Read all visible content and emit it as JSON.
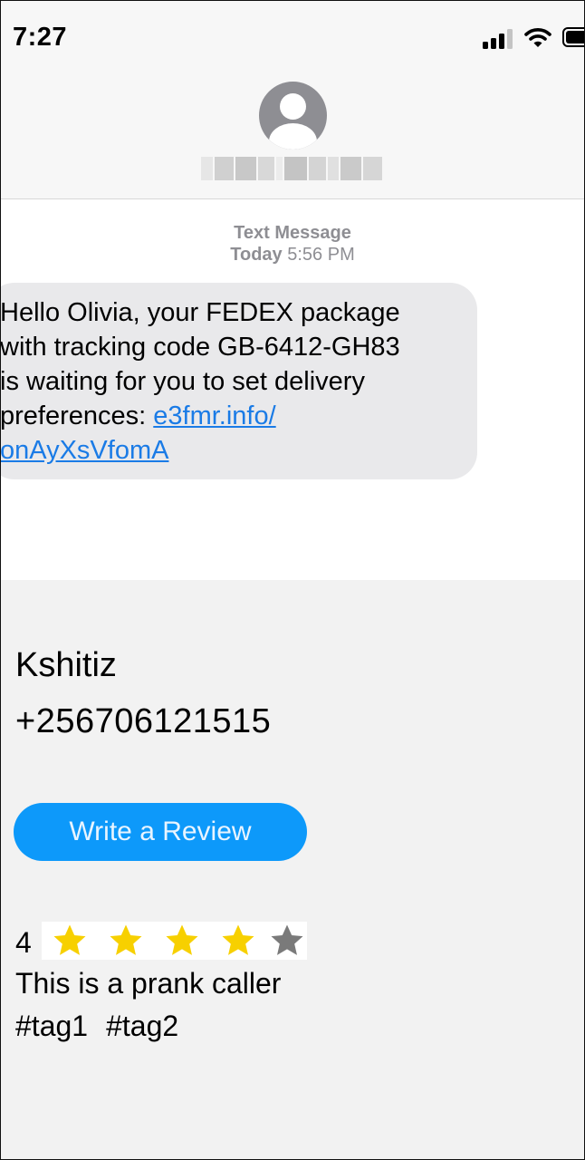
{
  "status_bar": {
    "time": "7:27"
  },
  "conversation": {
    "type_label": "Text Message",
    "day_label": "Today",
    "time_label": "5:56 PM",
    "message": {
      "lines": [
        "Hello Olivia, your FEDEX package",
        "with tracking code GB-6412-GH83",
        "is waiting for you to set delivery",
        "preferences: "
      ],
      "link_part1": "e3fmr.info/",
      "link_part2": "onAyXsVfomA"
    }
  },
  "caller": {
    "name": "Kshitiz",
    "number": "+256706121515"
  },
  "review_button": {
    "label": "Write a Review"
  },
  "review": {
    "rating_label": "4",
    "rating": 4,
    "max_rating": 5,
    "star_color": "#f7d000",
    "empty_star_color": "#7a7a7a",
    "text": "This is a prank caller",
    "tags": [
      "#tag1",
      "#tag2"
    ]
  },
  "colors": {
    "button": "#0d99fa",
    "link": "#1a7be6",
    "bubble": "#e9e9eb",
    "panel": "#f2f2f2"
  }
}
